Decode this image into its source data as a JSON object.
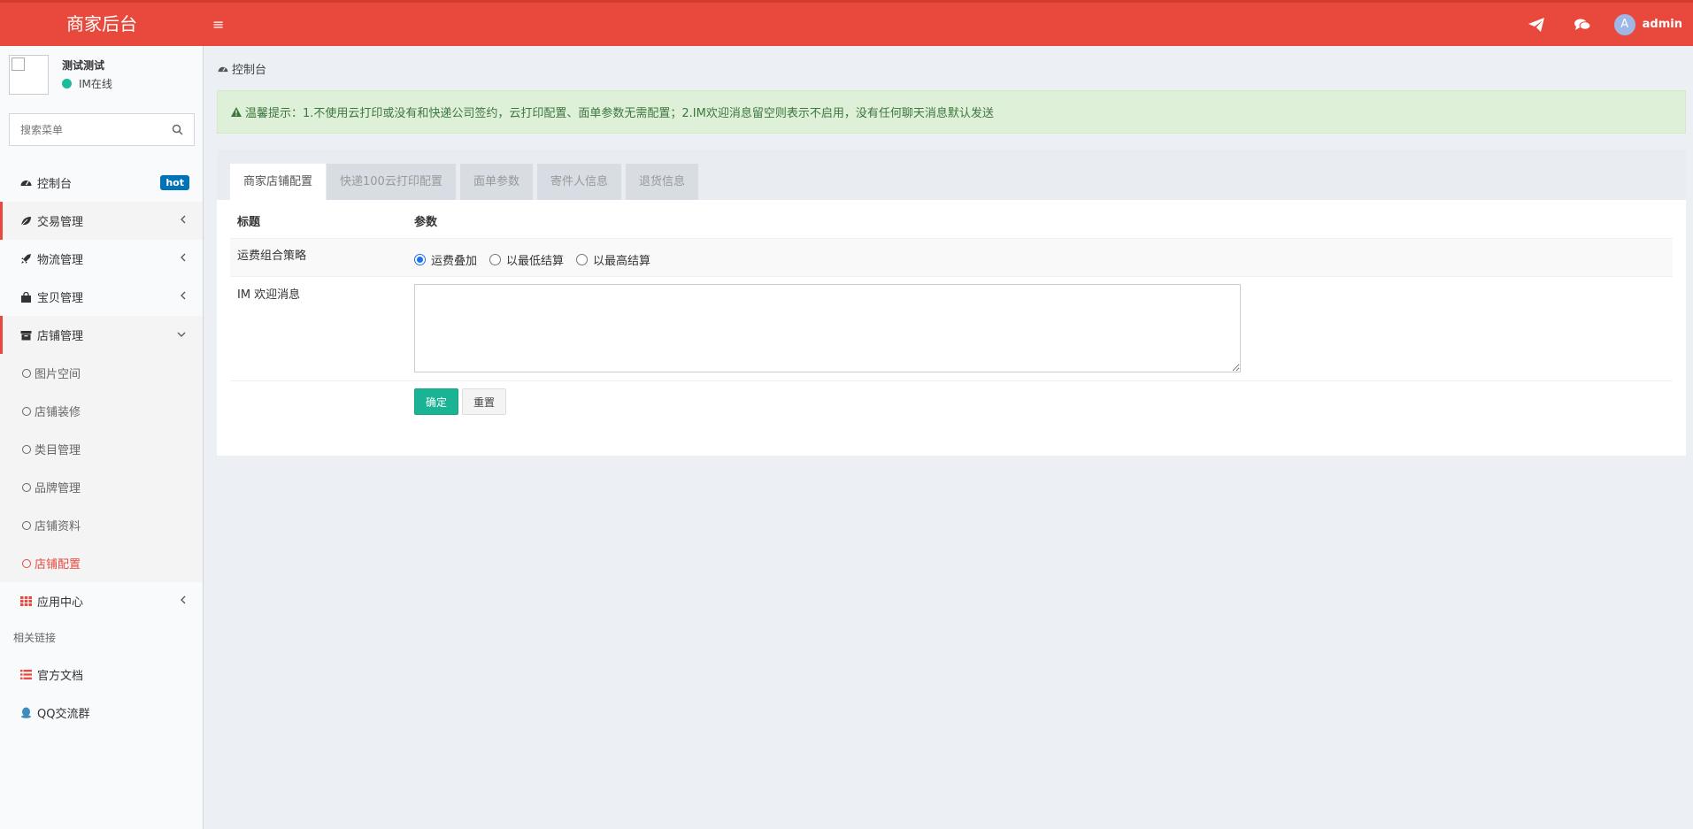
{
  "app": {
    "title": "商家后台"
  },
  "topbar": {
    "user_initial": "A",
    "user_name": "admin"
  },
  "sidebar": {
    "shop_name": "测试测试",
    "status": "IM在线",
    "search_placeholder": "搜索菜单",
    "items": [
      {
        "label": "控制台",
        "icon": "dashboard-icon",
        "badge": "hot"
      },
      {
        "label": "交易管理",
        "icon": "leaf-icon"
      },
      {
        "label": "物流管理",
        "icon": "rocket-icon"
      },
      {
        "label": "宝贝管理",
        "icon": "shopping-bag-icon"
      },
      {
        "label": "店铺管理",
        "icon": "archive-icon"
      },
      {
        "label": "应用中心",
        "icon": "grid-icon"
      }
    ],
    "submenu": [
      "图片空间",
      "店铺装修",
      "类目管理",
      "品牌管理",
      "店铺资料",
      "店铺配置"
    ],
    "links_header": "相关链接",
    "links": [
      {
        "label": "官方文档",
        "icon": "list-icon"
      },
      {
        "label": "QQ交流群",
        "icon": "qq-icon"
      }
    ]
  },
  "breadcrumb": "控制台",
  "alert": "温馨提示：1.不使用云打印或没有和快递公司签约，云打印配置、面单参数无需配置；2.IM欢迎消息留空则表示不启用，没有任何聊天消息默认发送",
  "tabs": [
    "商家店铺配置",
    "快递100云打印配置",
    "面单参数",
    "寄件人信息",
    "退货信息"
  ],
  "form": {
    "col_title": "标题",
    "col_param": "参数",
    "strategy_label": "运费组合策略",
    "strategy_options": [
      "运费叠加",
      "以最低结算",
      "以最高结算"
    ],
    "im_label": "IM 欢迎消息",
    "im_value": "",
    "ok_button": "确定",
    "reset_button": "重置"
  },
  "colors": {
    "brand": "#e9493d",
    "success": "#1ab394",
    "badge": "#0073b7"
  }
}
